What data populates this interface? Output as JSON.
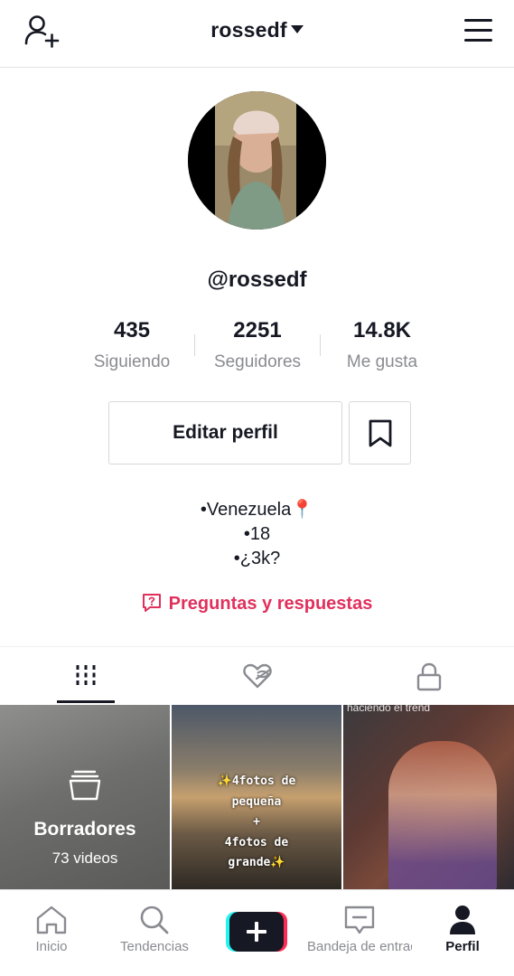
{
  "header": {
    "username_title": "rossedf",
    "add_user_icon": "add-user-icon",
    "menu_icon": "hamburger-menu-icon"
  },
  "profile": {
    "handle": "@rossedf",
    "avatar_icon": "profile-photo"
  },
  "stats": [
    {
      "value": "435",
      "label": "Siguiendo"
    },
    {
      "value": "2251",
      "label": "Seguidores"
    },
    {
      "value": "14.8K",
      "label": "Me gusta"
    }
  ],
  "actions": {
    "edit_profile": "Editar perfil",
    "bookmark_icon": "bookmark-icon"
  },
  "bio": {
    "line1": "•Venezuela📍",
    "line2": "•18",
    "line3": "•¿3k?"
  },
  "qa": {
    "label": "Preguntas y respuestas",
    "icon": "question-bubble-icon"
  },
  "tabs": [
    {
      "name": "videos",
      "icon": "grid-icon",
      "active": true
    },
    {
      "name": "liked",
      "icon": "heart-hidden-icon",
      "active": false
    },
    {
      "name": "private",
      "icon": "lock-icon",
      "active": false
    }
  ],
  "grid": {
    "drafts": {
      "title": "Borradores",
      "count": "73 videos"
    },
    "video2": {
      "line1": "✨4fotos de",
      "line2": "pequeña",
      "line3": "+",
      "line4": "4fotos de",
      "line5": "grande✨"
    },
    "video3": {
      "caption": "haciendo el trend"
    }
  },
  "bottom_nav": [
    {
      "label": "Inicio",
      "icon": "home-icon"
    },
    {
      "label": "Tendencias",
      "icon": "search-icon"
    },
    {
      "label": "",
      "icon": "create-plus-icon"
    },
    {
      "label": "Bandeja de entrada",
      "icon": "inbox-icon"
    },
    {
      "label": "Perfil",
      "icon": "profile-icon",
      "active": true
    }
  ],
  "colors": {
    "accent": "#e0315d",
    "text": "#161823",
    "muted": "#8a8b91",
    "border": "#d8d8da"
  }
}
